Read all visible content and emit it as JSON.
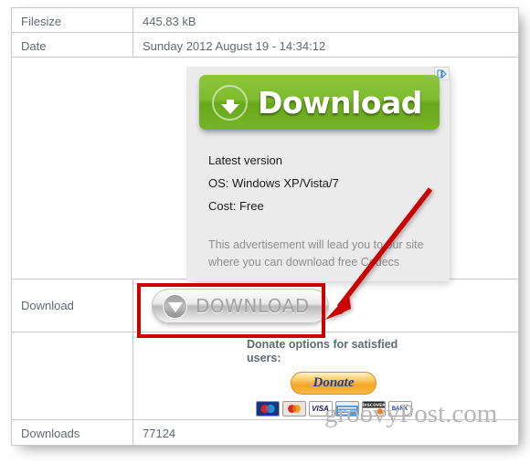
{
  "table": {
    "rows": [
      {
        "label": "Filesize",
        "value": "445.83 kB"
      },
      {
        "label": "Date",
        "value": "Sunday 2012 August 19 - 14:34:12"
      },
      {
        "label": "Download",
        "value": ""
      },
      {
        "label": "Downloads",
        "value": "77124"
      }
    ]
  },
  "advert": {
    "adchoices_icon": "adchoices-icon",
    "green_button": {
      "label": "Download",
      "icon": "download-arrow-icon",
      "color": "#7ebb2e"
    },
    "lines": [
      "Latest version",
      "OS: Windows XP/Vista/7",
      "Cost: Free"
    ],
    "disclaimer": "This advertisement will lead you to our site where you can download free Codecs"
  },
  "download": {
    "button_label": "DOWNLOAD",
    "button_icon": "download-triangle-icon"
  },
  "donate": {
    "title": "Donate options for satisfied users:",
    "button_label": "Donate",
    "cards": [
      {
        "name": "maestro",
        "text": "Maestro"
      },
      {
        "name": "mastercard",
        "text": "MasterCard"
      },
      {
        "name": "visa",
        "text": "VISA"
      },
      {
        "name": "amex",
        "text": "AMEX"
      },
      {
        "name": "discover",
        "text": "DISCOVER"
      },
      {
        "name": "bank",
        "text": "BANK"
      }
    ]
  },
  "annotation": {
    "highlight_color": "#cc0000",
    "arrow_color": "#cc0000"
  },
  "watermark": {
    "text": "groovyPost.com"
  }
}
